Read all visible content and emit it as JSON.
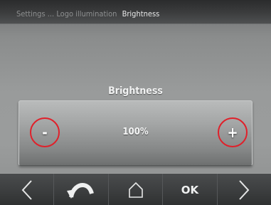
{
  "header": {
    "breadcrumb": {
      "settings": "Settings",
      "separator": "...",
      "logo_illumination": "Logo illumination",
      "current": "Brightness"
    }
  },
  "main": {
    "title": "Brightness",
    "value": "100%",
    "decrease_label": "-",
    "increase_label": "+"
  },
  "navbar": {
    "ok_label": "OK",
    "icons": [
      "chevron-left-icon",
      "back-arrow-icon",
      "home-icon",
      "chevron-right-icon"
    ]
  },
  "colors": {
    "highlight_circle": "#e0202a"
  }
}
